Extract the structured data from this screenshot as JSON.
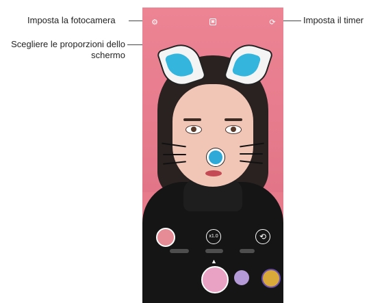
{
  "callouts": {
    "camera_settings": "Imposta la fotocamera",
    "aspect_ratio_line1": "Scegliere le proporzioni dello",
    "aspect_ratio_line2": "schermo",
    "timer": "Imposta il timer"
  },
  "controls": {
    "zoom_label": "x1.0"
  },
  "colors": {
    "background_pink": "#e77b8c",
    "cat_ear_inner": "#33b5dd",
    "nose": "#2ea9d8"
  },
  "icons": [
    "gear-icon",
    "aspect-ratio-icon",
    "timer-icon",
    "switch-camera-icon"
  ]
}
